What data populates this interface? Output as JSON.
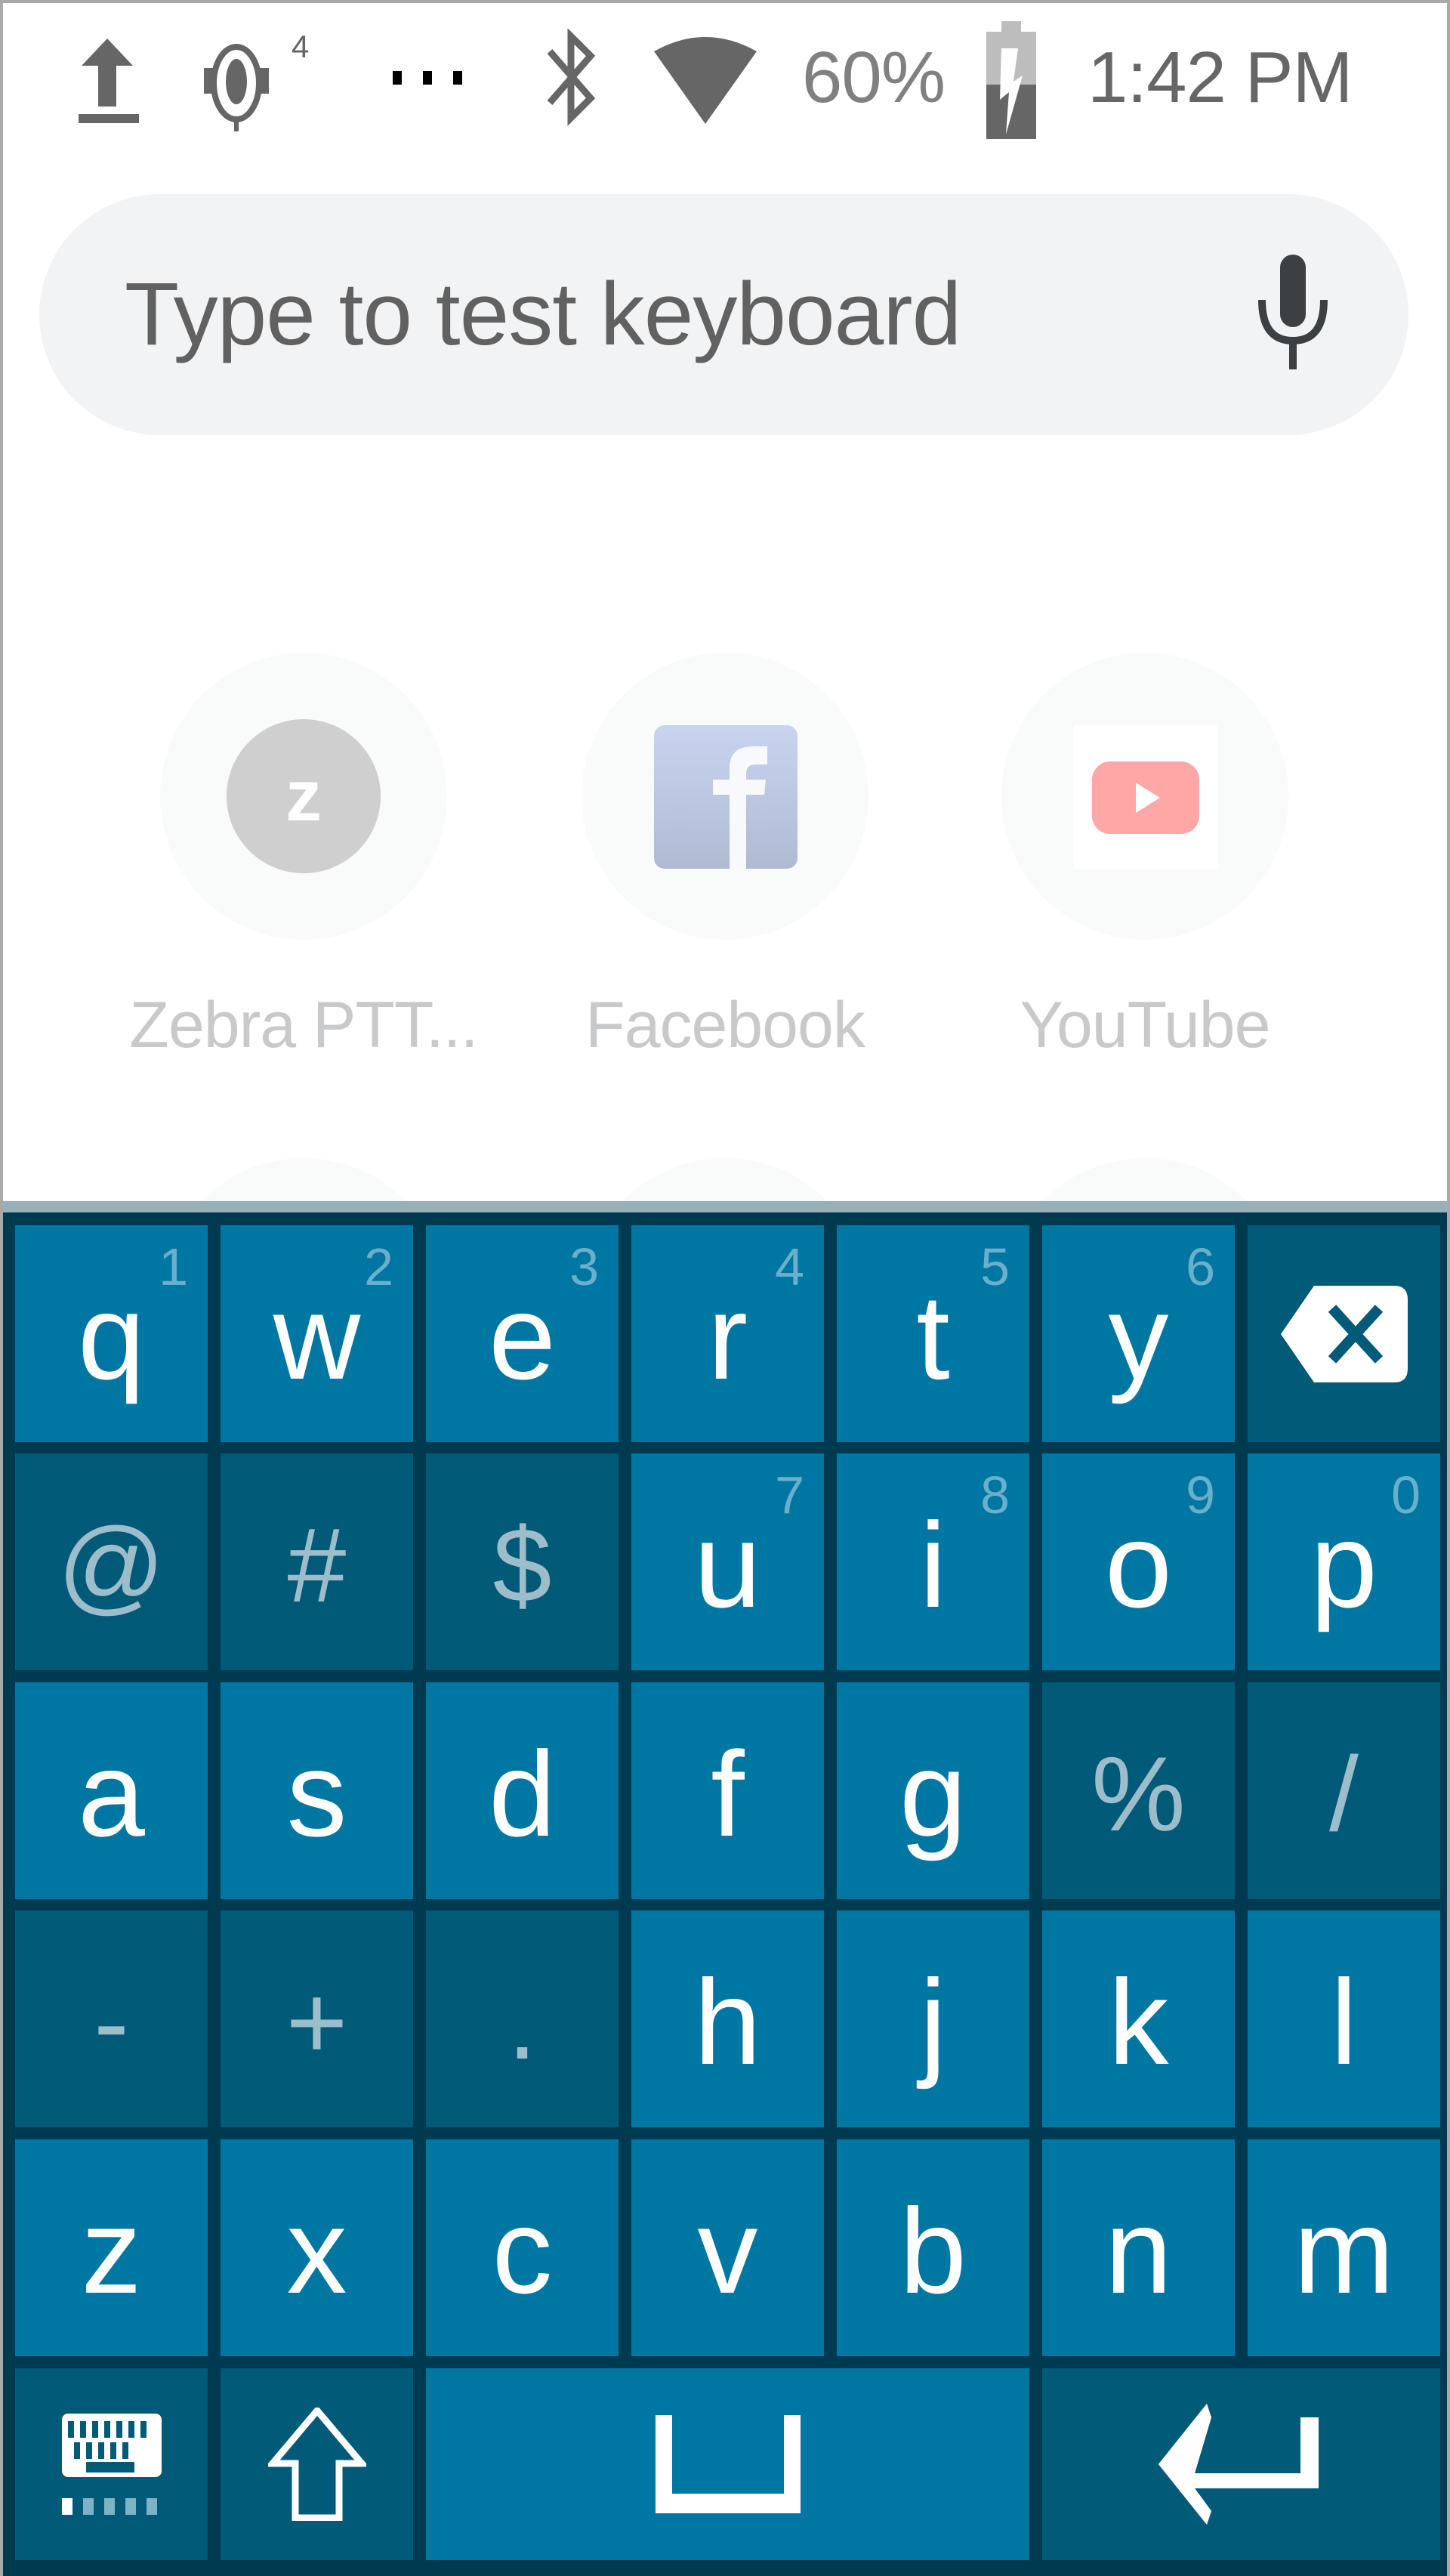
{
  "status_bar": {
    "icons": [
      "upload-icon",
      "ptt-headset-icon",
      "more-notifications-icon",
      "bluetooth-icon",
      "wifi-icon",
      "battery-charging-icon"
    ],
    "ptt_channel": "4",
    "overflow": "⋯",
    "battery_percent": "60%",
    "time": "1:42 PM"
  },
  "search": {
    "placeholder": "Type to test keyboard",
    "mic_icon": "mic-icon"
  },
  "apps": [
    {
      "label": "Zebra PTT...",
      "icon": "zebra-ptt-icon",
      "glyph": "z"
    },
    {
      "label": "Facebook",
      "icon": "facebook-icon",
      "glyph": "f"
    },
    {
      "label": "YouTube",
      "icon": "youtube-icon",
      "glyph": "▶"
    }
  ],
  "keyboard": {
    "colors": {
      "background": "#003a50",
      "key": "#0077a2",
      "key_dark": "#005a78",
      "hint": "#6aafcb",
      "symbol": "#9dbdcb"
    },
    "rows": [
      [
        {
          "label": "q",
          "hint": "1"
        },
        {
          "label": "w",
          "hint": "2"
        },
        {
          "label": "e",
          "hint": "3"
        },
        {
          "label": "r",
          "hint": "4"
        },
        {
          "label": "t",
          "hint": "5"
        },
        {
          "label": "y",
          "hint": "6"
        },
        {
          "label": "",
          "icon": "backspace-icon",
          "dark": true
        }
      ],
      [
        {
          "label": "@",
          "dark": true,
          "sym": true
        },
        {
          "label": "#",
          "dark": true,
          "sym": true
        },
        {
          "label": "$",
          "dark": true,
          "sym": true
        },
        {
          "label": "u",
          "hint": "7"
        },
        {
          "label": "i",
          "hint": "8"
        },
        {
          "label": "o",
          "hint": "9"
        },
        {
          "label": "p",
          "hint": "0"
        }
      ],
      [
        {
          "label": "a"
        },
        {
          "label": "s"
        },
        {
          "label": "d"
        },
        {
          "label": "f"
        },
        {
          "label": "g"
        },
        {
          "label": "%",
          "dark": true,
          "sym": true
        },
        {
          "label": "/",
          "dark": true,
          "sym": true
        }
      ],
      [
        {
          "label": "-",
          "dark": true,
          "sym": true
        },
        {
          "label": "+",
          "dark": true,
          "sym": true
        },
        {
          "label": ".",
          "dark": true,
          "sym": true
        },
        {
          "label": "h"
        },
        {
          "label": "j"
        },
        {
          "label": "k"
        },
        {
          "label": "l"
        }
      ],
      [
        {
          "label": "z"
        },
        {
          "label": "x"
        },
        {
          "label": "c"
        },
        {
          "label": "v"
        },
        {
          "label": "b"
        },
        {
          "label": "n"
        },
        {
          "label": "m"
        }
      ],
      [
        {
          "label": "",
          "icon": "keyboard-switch-icon",
          "dark": true
        },
        {
          "label": "",
          "icon": "shift-icon",
          "dark": true
        },
        {
          "label": "",
          "icon": "space-icon",
          "span": 3
        },
        {
          "label": "",
          "icon": "enter-icon",
          "dark": true,
          "span": 2
        }
      ]
    ]
  }
}
